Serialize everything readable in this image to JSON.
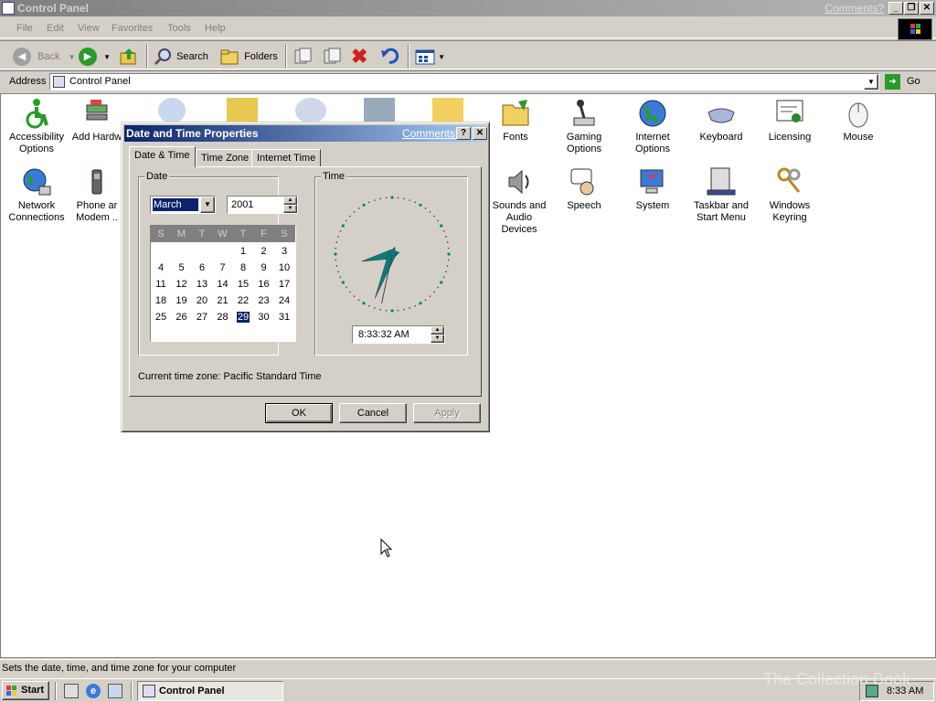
{
  "window": {
    "title": "Control Panel",
    "comments": "Comments?"
  },
  "menu": [
    "File",
    "Edit",
    "View",
    "Favorites",
    "Tools",
    "Help"
  ],
  "toolbar": {
    "back": "Back",
    "search": "Search",
    "folders": "Folders"
  },
  "address": {
    "label": "Address",
    "value": "Control Panel",
    "go": "Go"
  },
  "control_panel_items": [
    {
      "label": "Accessibility Options",
      "icon": "accessibility-icon"
    },
    {
      "label": "Add Hardw",
      "icon": "add-hardware-icon"
    },
    {
      "label": "Fonts",
      "icon": "fonts-folder-icon"
    },
    {
      "label": "Gaming Options",
      "icon": "joystick-icon"
    },
    {
      "label": "Internet Options",
      "icon": "globe-icon"
    },
    {
      "label": "Keyboard",
      "icon": "keyboard-icon"
    },
    {
      "label": "Licensing",
      "icon": "certificate-icon"
    },
    {
      "label": "Mouse",
      "icon": "mouse-icon"
    },
    {
      "label": "Network Connections",
      "icon": "network-globe-icon"
    },
    {
      "label": "Phone ar Modem ..",
      "icon": "phone-icon"
    },
    {
      "label": "Sounds and Audio Devices",
      "icon": "speaker-icon"
    },
    {
      "label": "Speech",
      "icon": "speech-icon"
    },
    {
      "label": "System",
      "icon": "computer-icon"
    },
    {
      "label": "Taskbar and Start Menu",
      "icon": "taskbar-icon"
    },
    {
      "label": "Windows Keyring",
      "icon": "keys-icon"
    }
  ],
  "dialog": {
    "title": "Date and Time Properties",
    "comments": "Comments?",
    "tabs": [
      "Date & Time",
      "Time Zone",
      "Internet Time"
    ],
    "date_group": "Date",
    "time_group": "Time",
    "month": "March",
    "year": "2001",
    "weekdays": [
      "S",
      "M",
      "T",
      "W",
      "T",
      "F",
      "S"
    ],
    "calendar_rows": [
      [
        "",
        "",
        "",
        "",
        "1",
        "2",
        "3"
      ],
      [
        "4",
        "5",
        "6",
        "7",
        "8",
        "9",
        "10"
      ],
      [
        "11",
        "12",
        "13",
        "14",
        "15",
        "16",
        "17"
      ],
      [
        "18",
        "19",
        "20",
        "21",
        "22",
        "23",
        "24"
      ],
      [
        "25",
        "26",
        "27",
        "28",
        "29",
        "30",
        "31"
      ]
    ],
    "selected_day": "29",
    "time": "8:33:32 AM",
    "clock": {
      "hour": 8,
      "minute": 33,
      "second": 32
    },
    "current_zone": "Current time zone:  Pacific Standard Time",
    "ok": "OK",
    "cancel": "Cancel",
    "apply": "Apply"
  },
  "status": "Sets the date, time, and time zone for your computer",
  "taskbar": {
    "start": "Start",
    "task": "Control Panel",
    "clock": "8:33 AM"
  },
  "watermark": "The Collection Book"
}
